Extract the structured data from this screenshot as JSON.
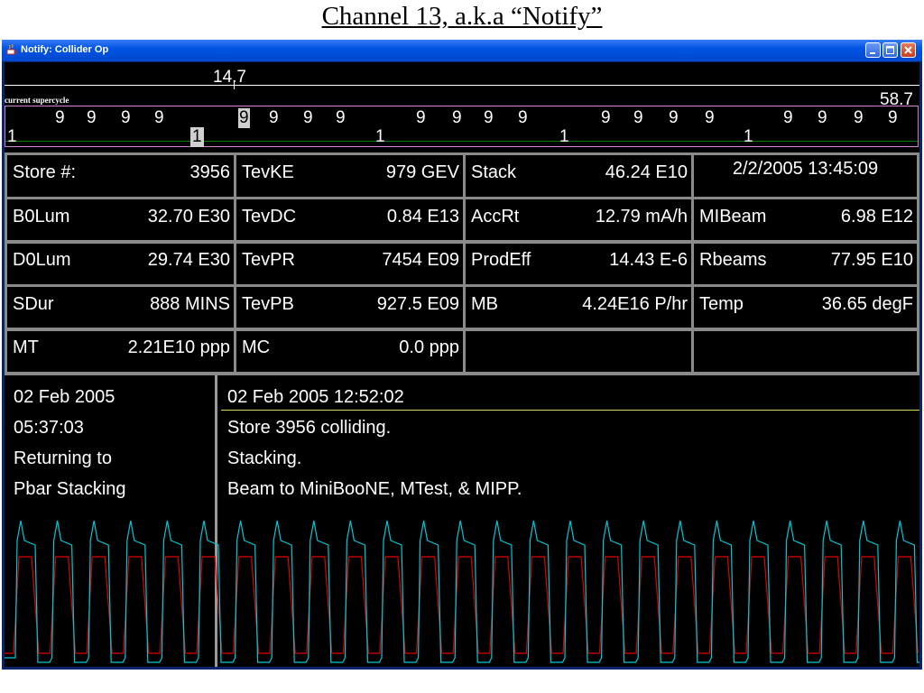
{
  "slide": {
    "title": "Channel 13, a.k.a “Notify”"
  },
  "window": {
    "title": "Notify: Collider Op",
    "app_icon": "coffee-cup-icon"
  },
  "supercycle": {
    "label": "current supercycle",
    "top_value": "14.7",
    "right_value": "58.7",
    "event_row_9": [
      "9",
      "9",
      "9",
      "9",
      "9",
      "9",
      "9",
      "9",
      "9",
      "9",
      "9",
      "9",
      "9",
      "9",
      "9",
      "9",
      "9",
      "9",
      "9",
      "9",
      "9"
    ],
    "event_row_1": [
      "1",
      "1",
      "1",
      "1",
      "1"
    ]
  },
  "grid": [
    [
      {
        "label": "Store #:",
        "value": "3956"
      },
      {
        "label": "TevKE",
        "value": "979 GEV"
      },
      {
        "label": "Stack",
        "value": "46.24  E10"
      },
      {
        "datetime": "2/2/2005 13:45:09"
      }
    ],
    [
      {
        "label": "B0Lum",
        "value": "32.70 E30"
      },
      {
        "label": "TevDC",
        "value": "0.84 E13"
      },
      {
        "label": "AccRt",
        "value": "12.79 mA/h"
      },
      {
        "label": "MIBeam",
        "value": "6.98 E12"
      }
    ],
    [
      {
        "label": "D0Lum",
        "value": "29.74 E30"
      },
      {
        "label": "TevPR",
        "value": "7454 E09"
      },
      {
        "label": "ProdEff",
        "value": "14.43 E-6"
      },
      {
        "label": "Rbeams",
        "value": "77.95 E10"
      }
    ],
    [
      {
        "label": "SDur",
        "value": "888 MINS"
      },
      {
        "label": "TevPB",
        "value": "927.5 E09"
      },
      {
        "label": "MB",
        "value": "4.24E16 P/hr"
      },
      {
        "label": "Temp",
        "value": "36.65 degF"
      }
    ],
    [
      {
        "label": "MT",
        "value": "2.21E10 ppp"
      },
      {
        "label": "MC",
        "value": "0.0 ppp"
      },
      {
        "label": "",
        "value": ""
      },
      {
        "label": "",
        "value": ""
      }
    ]
  ],
  "messages": {
    "left": [
      "02 Feb 2005",
      "05:37:03",
      "Returning to",
      "Pbar Stacking"
    ],
    "right_header": "02 Feb 2005 12:52:02",
    "right": [
      "Store 3956 colliding.",
      "Stacking.",
      "Beam to MiniBooNE, MTest, & MIPP."
    ]
  },
  "colors": {
    "trace_cyan": "#00c8d8",
    "trace_red": "#e00000",
    "grid_line": "#008000",
    "divider_yellow": "#d8d860",
    "band_border": "#d080d0"
  }
}
